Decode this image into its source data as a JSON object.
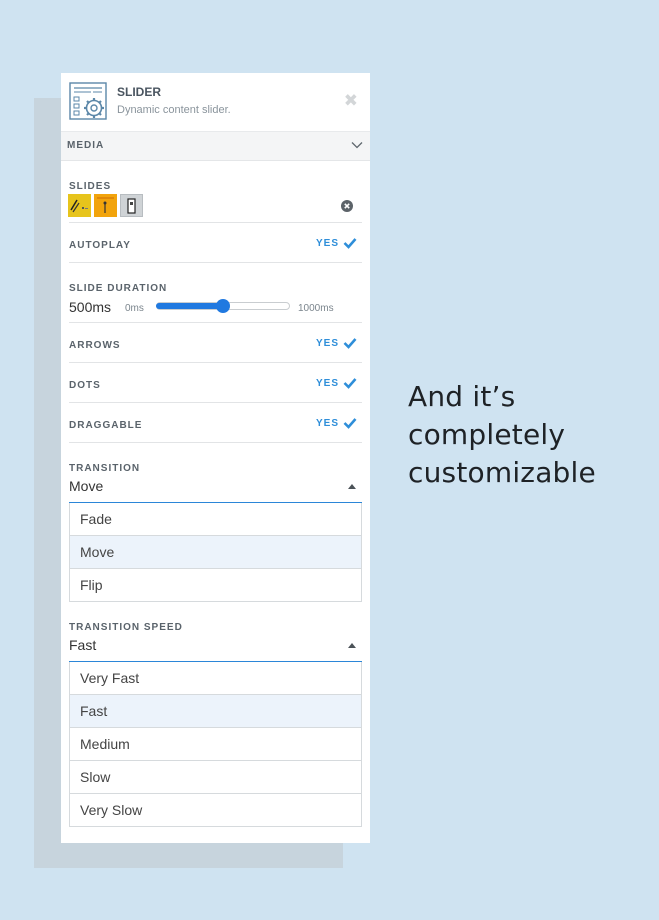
{
  "widget": {
    "title": "SLIDER",
    "description": "Dynamic content slider.",
    "close_icon": "close-icon"
  },
  "section": {
    "label": "MEDIA",
    "chevron_icon": "chevron-down-icon"
  },
  "slides": {
    "label": "SLIDES",
    "thumbnail_count": 3,
    "remove_icon": "remove-circle-icon"
  },
  "autoplay": {
    "label": "AUTOPLAY",
    "value": "YES"
  },
  "slide_duration": {
    "label": "SLIDE DURATION",
    "value": "500ms",
    "min": "0ms",
    "max": "1000ms",
    "fraction": 0.5
  },
  "arrows": {
    "label": "ARROWS",
    "value": "YES"
  },
  "dots": {
    "label": "DOTS",
    "value": "YES"
  },
  "draggable": {
    "label": "DRAGGABLE",
    "value": "YES"
  },
  "transition": {
    "label": "TRANSITION",
    "value": "Move",
    "options": [
      "Fade",
      "Move",
      "Flip"
    ],
    "selected_index": 1
  },
  "transition_speed": {
    "label": "TRANSITION SPEED",
    "value": "Fast",
    "options": [
      "Very Fast",
      "Fast",
      "Medium",
      "Slow",
      "Very Slow"
    ],
    "selected_index": 1
  },
  "tagline": "And it’s completely customizable",
  "colors": {
    "accent": "#2e8ed9",
    "background": "#cfe3f1",
    "selected_option": "#ecf3fb"
  }
}
